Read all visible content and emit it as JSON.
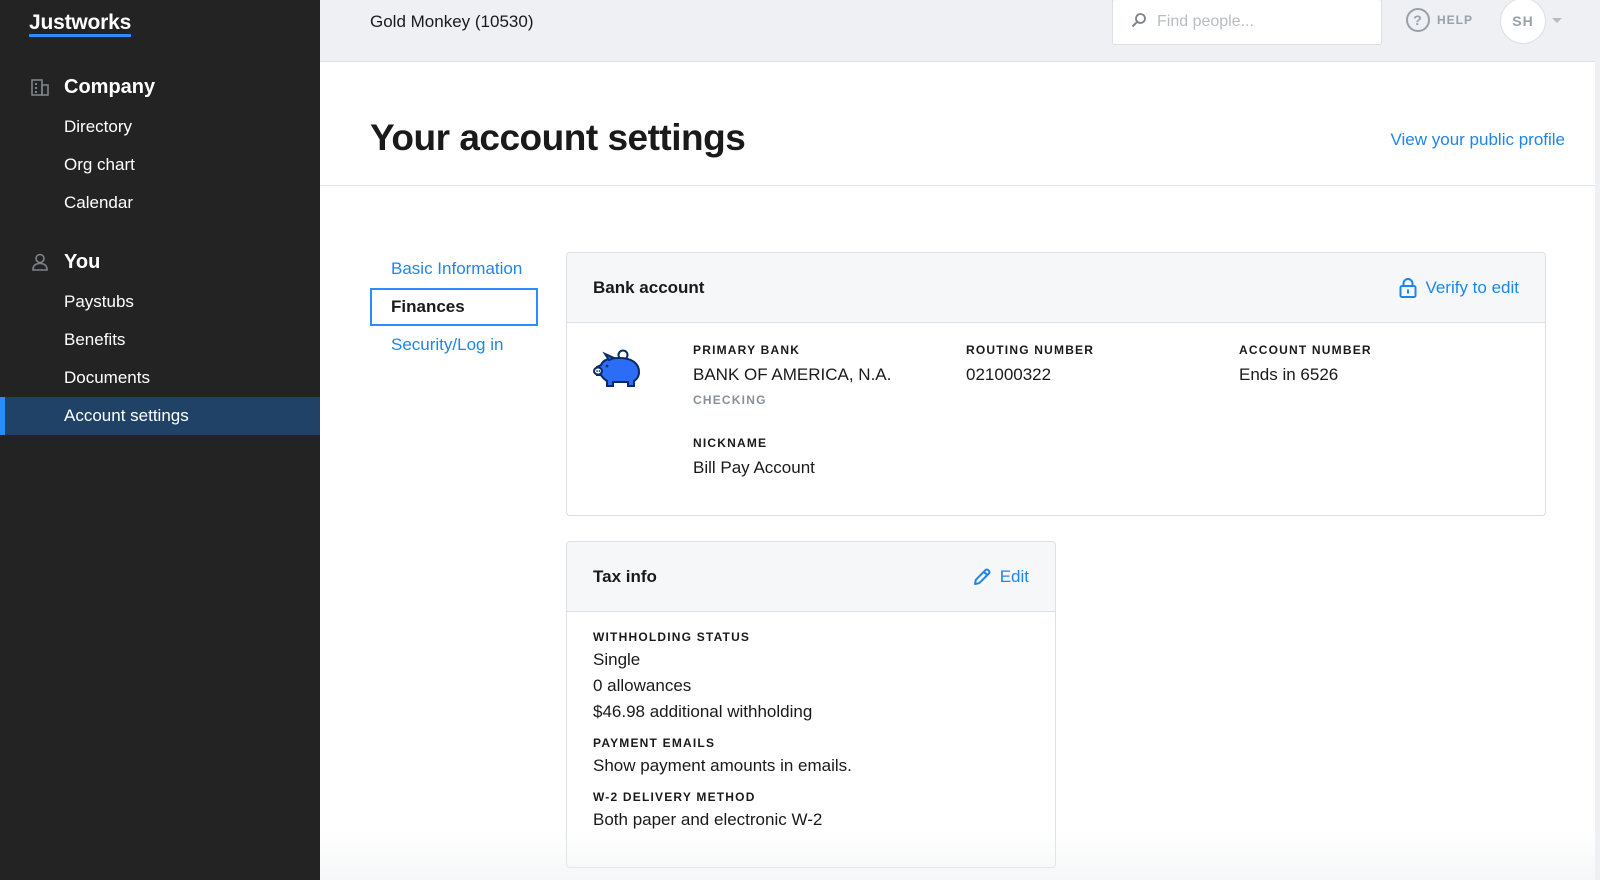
{
  "app": {
    "logo": "Justworks",
    "company_name": "Gold Monkey (10530)"
  },
  "sidebar": {
    "sections": [
      {
        "label": "Company",
        "icon": "building-icon",
        "items": [
          {
            "label": "Directory"
          },
          {
            "label": "Org chart"
          },
          {
            "label": "Calendar"
          }
        ]
      },
      {
        "label": "You",
        "icon": "person-icon",
        "items": [
          {
            "label": "Paystubs"
          },
          {
            "label": "Benefits"
          },
          {
            "label": "Documents"
          },
          {
            "label": "Account settings",
            "active": true
          }
        ]
      }
    ]
  },
  "topbar": {
    "search_placeholder": "Find people...",
    "help_label": "HELP",
    "avatar_initials": "SH"
  },
  "page": {
    "title": "Your account settings",
    "public_profile_link": "View your public profile"
  },
  "subnav": {
    "items": [
      {
        "label": "Basic Information"
      },
      {
        "label": "Finances",
        "active": true
      },
      {
        "label": "Security/Log in"
      }
    ]
  },
  "bank_account": {
    "title": "Bank account",
    "action_label": "Verify to edit",
    "primary_bank_label": "PRIMARY BANK",
    "primary_bank_value": "BANK OF AMERICA, N.A.",
    "account_type": "CHECKING",
    "routing_label": "ROUTING NUMBER",
    "routing_value": "021000322",
    "account_number_label": "ACCOUNT NUMBER",
    "account_number_value": "Ends in 6526",
    "nickname_label": "NICKNAME",
    "nickname_value": "Bill Pay Account"
  },
  "tax_info": {
    "title": "Tax info",
    "action_label": "Edit",
    "withholding_label": "WITHHOLDING STATUS",
    "withholding_lines": [
      "Single",
      "0 allowances",
      "$46.98 additional withholding"
    ],
    "payment_emails_label": "PAYMENT EMAILS",
    "payment_emails_value": "Show payment amounts in emails.",
    "w2_label": "W-2 DELIVERY METHOD",
    "w2_value": "Both paper and electronic W-2"
  },
  "colors": {
    "sidebar_bg": "#232323",
    "active_nav_bg": "#1f4266",
    "accent": "#2b8cff",
    "link": "#1f86e8"
  }
}
